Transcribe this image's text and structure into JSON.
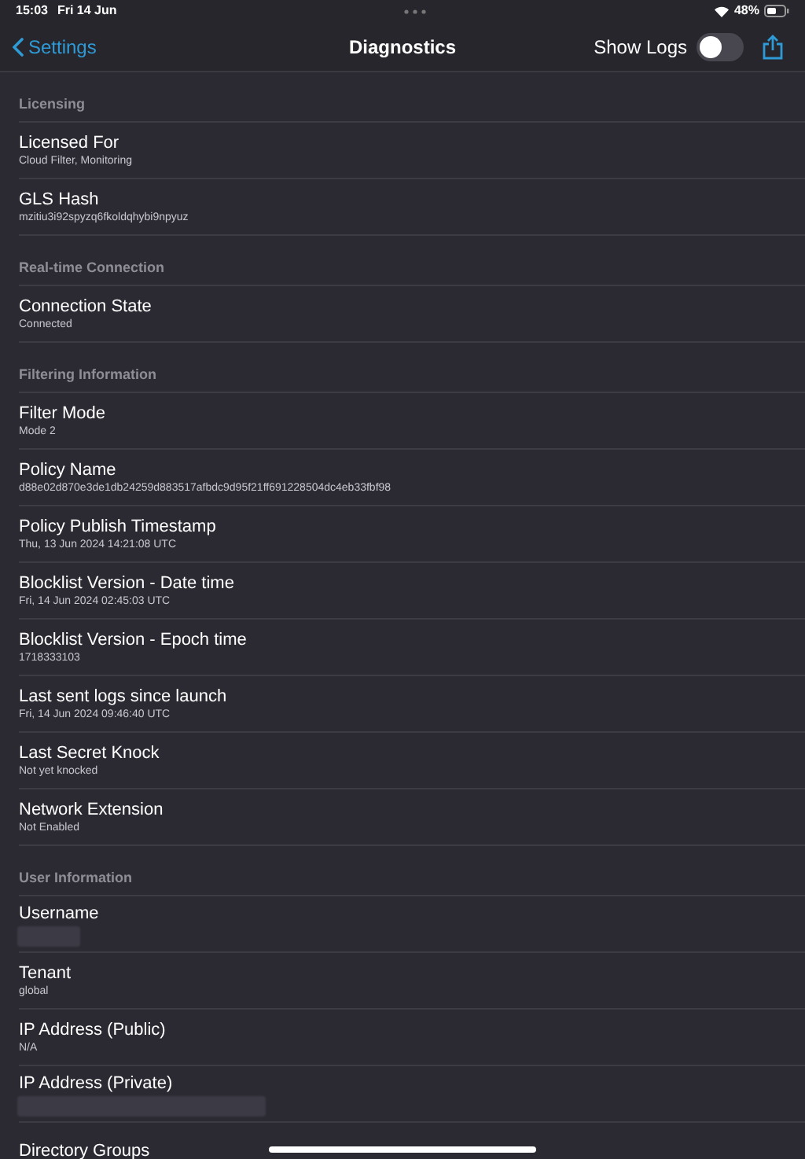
{
  "status_bar": {
    "time": "15:03",
    "date": "Fri 14 Jun",
    "battery": "48%"
  },
  "nav": {
    "back": "Settings",
    "title": "Diagnostics",
    "toggle_label": "Show Logs",
    "toggle_on": false
  },
  "sections": [
    {
      "header": "Licensing",
      "rows": [
        {
          "title": "Licensed For",
          "value": "Cloud Filter, Monitoring"
        },
        {
          "title": "GLS Hash",
          "value": "mzitiu3i92spyzq6fkoldqhybi9npyuz"
        }
      ]
    },
    {
      "header": "Real-time Connection",
      "rows": [
        {
          "title": "Connection State",
          "value": "Connected"
        }
      ]
    },
    {
      "header": "Filtering Information",
      "rows": [
        {
          "title": "Filter Mode",
          "value": "Mode 2"
        },
        {
          "title": "Policy Name",
          "value": "d88e02d870e3de1db24259d883517afbdc9d95f21ff691228504dc4eb33fbf98"
        },
        {
          "title": "Policy Publish Timestamp",
          "value": "Thu, 13 Jun 2024 14:21:08 UTC"
        },
        {
          "title": "Blocklist Version - Date time",
          "value": "Fri, 14 Jun 2024 02:45:03 UTC"
        },
        {
          "title": "Blocklist Version - Epoch time",
          "value": "1718333103"
        },
        {
          "title": "Last sent logs since launch",
          "value": "Fri, 14 Jun 2024 09:46:40 UTC"
        },
        {
          "title": "Last Secret Knock",
          "value": "Not yet knocked"
        },
        {
          "title": "Network Extension",
          "value": "Not Enabled"
        }
      ]
    },
    {
      "header": "User Information",
      "rows": [
        {
          "title": "Username",
          "kind": "masked"
        },
        {
          "title": "Tenant",
          "value": "global"
        },
        {
          "title": "IP Address (Public)",
          "value": "N/A"
        },
        {
          "title": "IP Address (Private)",
          "kind": "masked_wide"
        },
        {
          "title": "Directory Groups"
        }
      ]
    }
  ]
}
